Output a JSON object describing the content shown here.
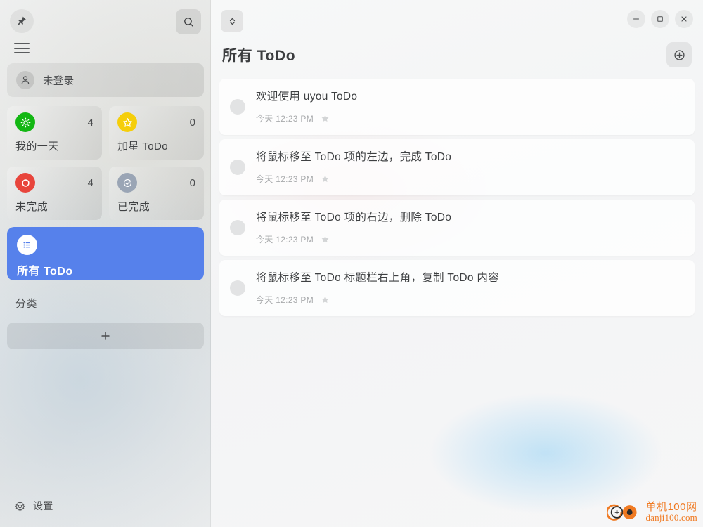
{
  "sidebar": {
    "pin_icon": "pin-icon",
    "search_icon": "search-icon",
    "menu_icon": "hamburger-menu-icon",
    "user": {
      "avatar_icon": "user-avatar-icon",
      "name": "未登录"
    },
    "cards": [
      {
        "icon": "sun-icon",
        "label": "我的一天",
        "count": "4",
        "color": "#13b713"
      },
      {
        "icon": "star-icon",
        "label": "加星 ToDo",
        "count": "0",
        "color": "#f5ce0a"
      },
      {
        "icon": "circle-icon",
        "label": "未完成",
        "count": "4",
        "color": "#e8453c"
      },
      {
        "icon": "check-circle-icon",
        "label": "已完成",
        "count": "0",
        "color": "#9aa5b5"
      }
    ],
    "active_nav": {
      "icon": "list-icon",
      "label": "所有 ToDo",
      "color": "#5681eb"
    },
    "section_title": "分类",
    "add_category_icon": "plus-icon",
    "settings": {
      "icon": "gear-icon",
      "label": "设置"
    }
  },
  "main": {
    "sort_icon": "sort-updown-icon",
    "window_controls": [
      {
        "name": "minimize-button",
        "glyph": "–"
      },
      {
        "name": "maximize-button",
        "glyph": "□"
      },
      {
        "name": "close-button",
        "glyph": "✕"
      }
    ],
    "title": "所有 ToDo",
    "add_todo_icon": "plus-circle-icon",
    "todos": [
      {
        "text": "欢迎使用 uyou ToDo",
        "time": "今天 12:23 PM",
        "star_icon": "star-icon",
        "done": false
      },
      {
        "text": "将鼠标移至 ToDo 项的左边，完成 ToDo",
        "time": "今天 12:23 PM",
        "star_icon": "star-icon",
        "done": false
      },
      {
        "text": "将鼠标移至 ToDo 项的右边，删除 ToDo",
        "time": "今天 12:23 PM",
        "star_icon": "star-icon",
        "done": false
      },
      {
        "text": "将鼠标移至 ToDo 标题栏右上角，复制 ToDo 内容",
        "time": "今天 12:23 PM",
        "star_icon": "star-icon",
        "done": false
      }
    ]
  },
  "watermark": {
    "cn": "单机100网",
    "en": "danji100.com",
    "color": "#f07a22"
  }
}
